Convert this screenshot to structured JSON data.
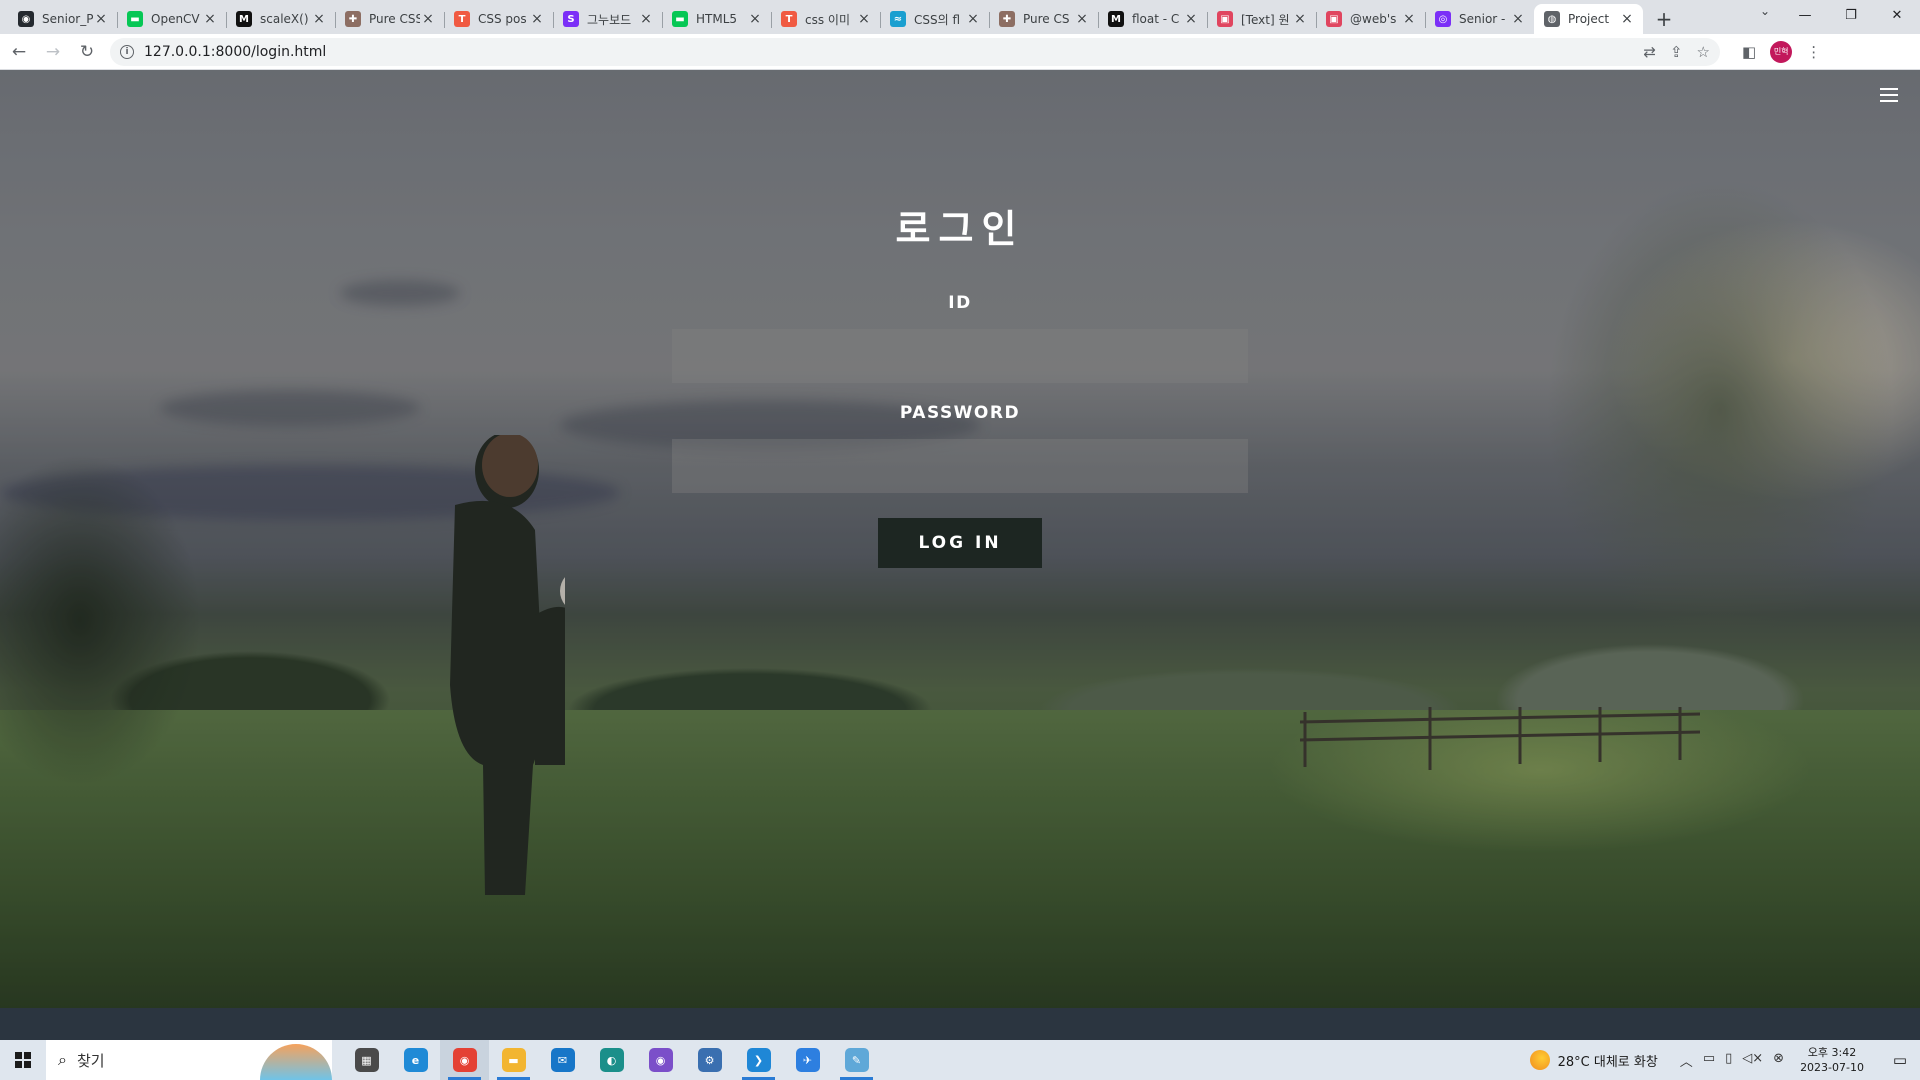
{
  "browser": {
    "tabs": [
      {
        "title": "Senior_P",
        "icon": "github-icon",
        "color": "#24292f",
        "glyph": "◉"
      },
      {
        "title": "OpenCV",
        "icon": "line-icon",
        "color": "#06c755",
        "glyph": "▬"
      },
      {
        "title": "scaleX()",
        "icon": "mdn-icon",
        "color": "#111111",
        "glyph": "M"
      },
      {
        "title": "Pure CSS",
        "icon": "puzzle-icon",
        "color": "#8d6e63",
        "glyph": "✚"
      },
      {
        "title": "CSS pos",
        "icon": "tistory-icon",
        "color": "#f05a42",
        "glyph": "T"
      },
      {
        "title": "그누보드",
        "icon": "sir-icon",
        "color": "#7b2ff7",
        "glyph": "S"
      },
      {
        "title": "HTML5",
        "icon": "line-icon",
        "color": "#06c755",
        "glyph": "▬"
      },
      {
        "title": "css 이미",
        "icon": "tistory-icon",
        "color": "#f05a42",
        "glyph": "T"
      },
      {
        "title": "CSS의 fl",
        "icon": "chart-icon",
        "color": "#1a9fd0",
        "glyph": "≈"
      },
      {
        "title": "Pure CS",
        "icon": "puzzle-icon",
        "color": "#8d6e63",
        "glyph": "✚"
      },
      {
        "title": "float - C",
        "icon": "mdn-icon",
        "color": "#111111",
        "glyph": "M"
      },
      {
        "title": "[Text] 원",
        "icon": "picture-icon",
        "color": "#e0455f",
        "glyph": "▣"
      },
      {
        "title": "@web's",
        "icon": "picture-icon",
        "color": "#e0455f",
        "glyph": "▣"
      },
      {
        "title": "Senior -",
        "icon": "figma-icon",
        "color": "#7b2ff7",
        "glyph": "◎"
      },
      {
        "title": "Project",
        "icon": "globe-icon",
        "color": "#5f6368",
        "glyph": "◍",
        "active": true
      }
    ],
    "url": "127.0.0.1:8000/login.html",
    "profile_label": "민혁"
  },
  "page": {
    "title": "로그인",
    "id_label": "ID",
    "id_value": "",
    "password_label": "PASSWORD",
    "password_value": "",
    "login_button": "LOG IN"
  },
  "taskbar": {
    "search_placeholder": "찾기",
    "apps": [
      {
        "name": "task-view-icon",
        "color": "#4a4a4a",
        "glyph": "▦"
      },
      {
        "name": "edge-icon",
        "color": "#1f8ad6",
        "glyph": "e"
      },
      {
        "name": "chrome-icon",
        "color": "#e44134",
        "glyph": "◉",
        "open": true,
        "active": true
      },
      {
        "name": "file-explorer-icon",
        "color": "#f2b531",
        "glyph": "▬",
        "open": true
      },
      {
        "name": "mail-icon",
        "color": "#1776c8",
        "glyph": "✉"
      },
      {
        "name": "app-teal-icon",
        "color": "#1b8f8a",
        "glyph": "◐"
      },
      {
        "name": "github-desktop-icon",
        "color": "#7b4fc9",
        "glyph": "◉"
      },
      {
        "name": "python-icon",
        "color": "#3a6fb0",
        "glyph": "⚙"
      },
      {
        "name": "vscode-icon",
        "color": "#1f87d6",
        "glyph": "❯",
        "open": true
      },
      {
        "name": "app-blue-icon",
        "color": "#2d7fe0",
        "glyph": "✈"
      },
      {
        "name": "notepad-icon",
        "color": "#5fa8d8",
        "glyph": "✎",
        "open": true
      }
    ],
    "weather": "28°C  대체로 화창",
    "time": "오후 3:42",
    "date": "2023-07-10"
  }
}
